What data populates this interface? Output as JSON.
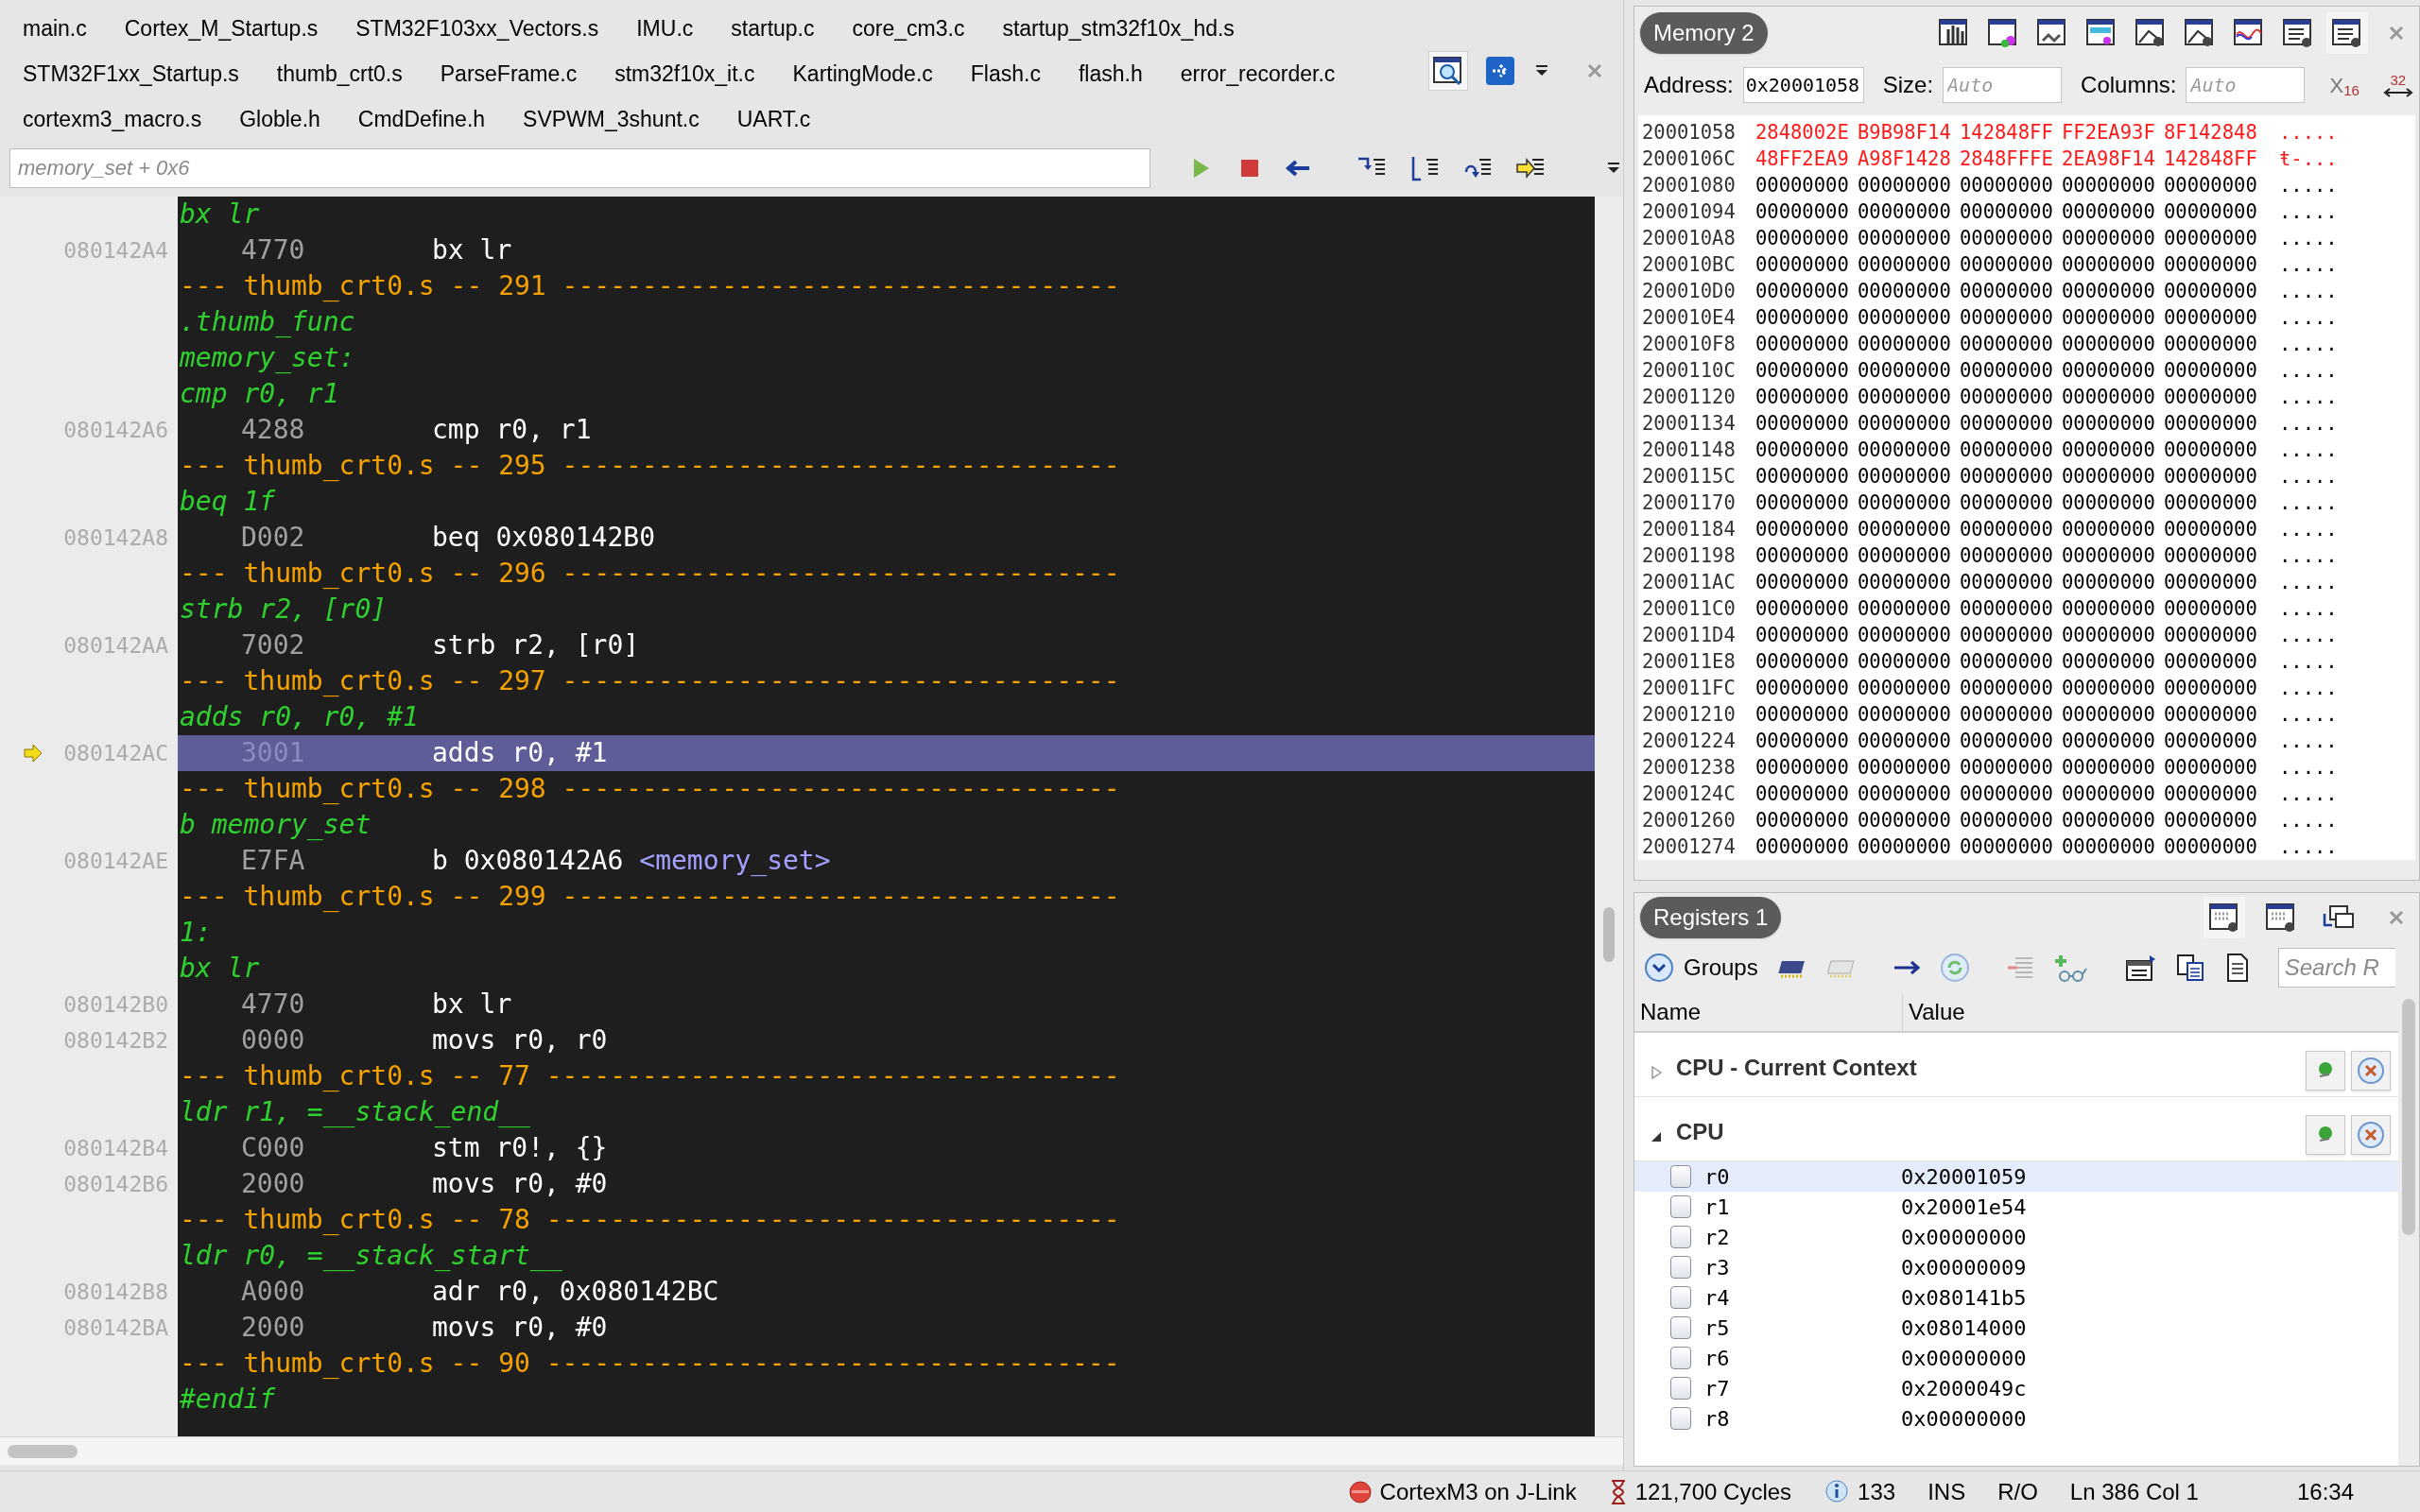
{
  "editor_tabs": [
    [
      "main.c",
      "Cortex_M_Startup.s",
      "STM32F103xx_Vectors.s",
      "IMU.c",
      "startup.c",
      "core_cm3.c",
      "startup_stm32f10x_hd.s"
    ],
    [
      "STM32F1xx_Startup.s",
      "thumb_crt0.s",
      "ParseFrame.c",
      "stm32f10x_it.c",
      "KartingMode.c",
      "Flash.c",
      "flash.h",
      "error_recorder.c"
    ],
    [
      "cortexm3_macro.s",
      "Globle.h",
      "CmdDefine.h",
      "SVPWM_3shunt.c",
      "UART.c"
    ]
  ],
  "location_field": {
    "placeholder": "memory_set + 0x6"
  },
  "disassembly": [
    {
      "kind": "source",
      "text": "bx lr"
    },
    {
      "kind": "instruction",
      "address": "080142A4",
      "opcode": "4770",
      "text": "bx lr",
      "current": false
    },
    {
      "kind": "file",
      "text": "--- thumb_crt0.s -- 291 -----------------------------------"
    },
    {
      "kind": "source",
      "text": ".thumb_func"
    },
    {
      "kind": "source",
      "text": "memory_set:"
    },
    {
      "kind": "source",
      "text": "cmp r0, r1"
    },
    {
      "kind": "instruction",
      "address": "080142A6",
      "opcode": "4288",
      "text": "cmp r0, r1",
      "current": false
    },
    {
      "kind": "file",
      "text": "--- thumb_crt0.s -- 295 -----------------------------------"
    },
    {
      "kind": "source",
      "text": "beq 1f"
    },
    {
      "kind": "instruction",
      "address": "080142A8",
      "opcode": "D002",
      "text": "beq 0x080142B0",
      "current": false
    },
    {
      "kind": "file",
      "text": "--- thumb_crt0.s -- 296 -----------------------------------"
    },
    {
      "kind": "source",
      "text": "strb r2, [r0]"
    },
    {
      "kind": "instruction",
      "address": "080142AA",
      "opcode": "7002",
      "text": "strb r2, [r0]",
      "current": false
    },
    {
      "kind": "file",
      "text": "--- thumb_crt0.s -- 297 -----------------------------------"
    },
    {
      "kind": "source",
      "text": "adds r0, r0, #1"
    },
    {
      "kind": "instruction",
      "address": "080142AC",
      "opcode": "3001",
      "text": "adds r0, #1",
      "current": true
    },
    {
      "kind": "file",
      "text": "--- thumb_crt0.s -- 298 -----------------------------------"
    },
    {
      "kind": "source",
      "text": "b memory_set"
    },
    {
      "kind": "instruction",
      "address": "080142AE",
      "opcode": "E7FA",
      "text": "b 0x080142A6",
      "symbol": "<memory_set>",
      "current": false
    },
    {
      "kind": "file",
      "text": "--- thumb_crt0.s -- 299 -----------------------------------"
    },
    {
      "kind": "source",
      "text": "1:"
    },
    {
      "kind": "source",
      "text": "bx lr"
    },
    {
      "kind": "instruction",
      "address": "080142B0",
      "opcode": "4770",
      "text": "bx lr",
      "current": false
    },
    {
      "kind": "instruction",
      "address": "080142B2",
      "opcode": "0000",
      "text": "movs r0, r0",
      "current": false
    },
    {
      "kind": "file",
      "text": "--- thumb_crt0.s -- 77 ------------------------------------"
    },
    {
      "kind": "source",
      "text": "ldr r1, =__stack_end__"
    },
    {
      "kind": "instruction",
      "address": "080142B4",
      "opcode": "C000",
      "text": "stm r0!, {}",
      "current": false
    },
    {
      "kind": "instruction",
      "address": "080142B6",
      "opcode": "2000",
      "text": "movs r0, #0",
      "current": false
    },
    {
      "kind": "file",
      "text": "--- thumb_crt0.s -- 78 ------------------------------------"
    },
    {
      "kind": "source",
      "text": "ldr r0, =__stack_start__"
    },
    {
      "kind": "instruction",
      "address": "080142B8",
      "opcode": "A000",
      "text": "adr r0, 0x080142BC",
      "current": false
    },
    {
      "kind": "instruction",
      "address": "080142BA",
      "opcode": "2000",
      "text": "movs r0, #0",
      "current": false
    },
    {
      "kind": "file",
      "text": "--- thumb_crt0.s -- 90 ------------------------------------"
    },
    {
      "kind": "source",
      "text": "#endif"
    }
  ],
  "memory": {
    "title": "Memory 2",
    "address_label": "Address:",
    "address": "0x20001058",
    "size_label": "Size:",
    "size_placeholder": "Auto",
    "columns_label": "Columns:",
    "columns_placeholder": "Auto",
    "radix_button": "X$_{16}$",
    "width_button": "32",
    "rows": [
      {
        "address": "20001058",
        "cells": [
          "2848002E",
          "B9B98F14",
          "142848FF",
          "FF2EA93F",
          "8F142848"
        ],
        "ascii": ".....",
        "changed": true
      },
      {
        "address": "2000106C",
        "cells": [
          "48FF2EA9",
          "A98F1428",
          "2848FFFE",
          "2EA98F14",
          "142848FF"
        ],
        "ascii": "ŧ-...",
        "changed": true
      },
      {
        "address": "20001080",
        "cells": [
          "00000000",
          "00000000",
          "00000000",
          "00000000",
          "00000000"
        ],
        "ascii": ".....",
        "changed": false
      },
      {
        "address": "20001094",
        "cells": [
          "00000000",
          "00000000",
          "00000000",
          "00000000",
          "00000000"
        ],
        "ascii": ".....",
        "changed": false
      },
      {
        "address": "200010A8",
        "cells": [
          "00000000",
          "00000000",
          "00000000",
          "00000000",
          "00000000"
        ],
        "ascii": ".....",
        "changed": false
      },
      {
        "address": "200010BC",
        "cells": [
          "00000000",
          "00000000",
          "00000000",
          "00000000",
          "00000000"
        ],
        "ascii": ".....",
        "changed": false
      },
      {
        "address": "200010D0",
        "cells": [
          "00000000",
          "00000000",
          "00000000",
          "00000000",
          "00000000"
        ],
        "ascii": ".....",
        "changed": false
      },
      {
        "address": "200010E4",
        "cells": [
          "00000000",
          "00000000",
          "00000000",
          "00000000",
          "00000000"
        ],
        "ascii": ".....",
        "changed": false
      },
      {
        "address": "200010F8",
        "cells": [
          "00000000",
          "00000000",
          "00000000",
          "00000000",
          "00000000"
        ],
        "ascii": ".....",
        "changed": false
      },
      {
        "address": "2000110C",
        "cells": [
          "00000000",
          "00000000",
          "00000000",
          "00000000",
          "00000000"
        ],
        "ascii": ".....",
        "changed": false
      },
      {
        "address": "20001120",
        "cells": [
          "00000000",
          "00000000",
          "00000000",
          "00000000",
          "00000000"
        ],
        "ascii": ".....",
        "changed": false
      },
      {
        "address": "20001134",
        "cells": [
          "00000000",
          "00000000",
          "00000000",
          "00000000",
          "00000000"
        ],
        "ascii": ".....",
        "changed": false
      },
      {
        "address": "20001148",
        "cells": [
          "00000000",
          "00000000",
          "00000000",
          "00000000",
          "00000000"
        ],
        "ascii": ".....",
        "changed": false
      },
      {
        "address": "2000115C",
        "cells": [
          "00000000",
          "00000000",
          "00000000",
          "00000000",
          "00000000"
        ],
        "ascii": ".....",
        "changed": false
      },
      {
        "address": "20001170",
        "cells": [
          "00000000",
          "00000000",
          "00000000",
          "00000000",
          "00000000"
        ],
        "ascii": ".....",
        "changed": false
      },
      {
        "address": "20001184",
        "cells": [
          "00000000",
          "00000000",
          "00000000",
          "00000000",
          "00000000"
        ],
        "ascii": ".....",
        "changed": false
      },
      {
        "address": "20001198",
        "cells": [
          "00000000",
          "00000000",
          "00000000",
          "00000000",
          "00000000"
        ],
        "ascii": ".....",
        "changed": false
      },
      {
        "address": "200011AC",
        "cells": [
          "00000000",
          "00000000",
          "00000000",
          "00000000",
          "00000000"
        ],
        "ascii": ".....",
        "changed": false
      },
      {
        "address": "200011C0",
        "cells": [
          "00000000",
          "00000000",
          "00000000",
          "00000000",
          "00000000"
        ],
        "ascii": ".....",
        "changed": false
      },
      {
        "address": "200011D4",
        "cells": [
          "00000000",
          "00000000",
          "00000000",
          "00000000",
          "00000000"
        ],
        "ascii": ".....",
        "changed": false
      },
      {
        "address": "200011E8",
        "cells": [
          "00000000",
          "00000000",
          "00000000",
          "00000000",
          "00000000"
        ],
        "ascii": ".....",
        "changed": false
      },
      {
        "address": "200011FC",
        "cells": [
          "00000000",
          "00000000",
          "00000000",
          "00000000",
          "00000000"
        ],
        "ascii": ".....",
        "changed": false
      },
      {
        "address": "20001210",
        "cells": [
          "00000000",
          "00000000",
          "00000000",
          "00000000",
          "00000000"
        ],
        "ascii": ".....",
        "changed": false
      },
      {
        "address": "20001224",
        "cells": [
          "00000000",
          "00000000",
          "00000000",
          "00000000",
          "00000000"
        ],
        "ascii": ".....",
        "changed": false
      },
      {
        "address": "20001238",
        "cells": [
          "00000000",
          "00000000",
          "00000000",
          "00000000",
          "00000000"
        ],
        "ascii": ".....",
        "changed": false
      },
      {
        "address": "2000124C",
        "cells": [
          "00000000",
          "00000000",
          "00000000",
          "00000000",
          "00000000"
        ],
        "ascii": ".....",
        "changed": false
      },
      {
        "address": "20001260",
        "cells": [
          "00000000",
          "00000000",
          "00000000",
          "00000000",
          "00000000"
        ],
        "ascii": ".....",
        "changed": false
      },
      {
        "address": "20001274",
        "cells": [
          "00000000",
          "00000000",
          "00000000",
          "00000000",
          "00000000"
        ],
        "ascii": ".....",
        "changed": false
      }
    ]
  },
  "registers": {
    "title": "Registers 1",
    "groups_label": "Groups",
    "search_placeholder": "Search R",
    "columns": [
      "Name",
      "Value"
    ],
    "groups": [
      {
        "name": "CPU - Current Context",
        "expanded": false
      },
      {
        "name": "CPU",
        "expanded": true,
        "children": [
          {
            "name": "r0",
            "value": "0x20001059",
            "selected": true
          },
          {
            "name": "r1",
            "value": "0x20001e54",
            "selected": false
          },
          {
            "name": "r2",
            "value": "0x00000000",
            "selected": false
          },
          {
            "name": "r3",
            "value": "0x00000009",
            "selected": false
          },
          {
            "name": "r4",
            "value": "0x080141b5",
            "selected": false
          },
          {
            "name": "r5",
            "value": "0x08014000",
            "selected": false
          },
          {
            "name": "r6",
            "value": "0x00000000",
            "selected": false
          },
          {
            "name": "r7",
            "value": "0x2000049c",
            "selected": false
          },
          {
            "name": "r8",
            "value": "0x00000000",
            "selected": false
          }
        ]
      }
    ]
  },
  "status_bar": {
    "target": "CortexM3 on J-Link",
    "cycles": "121,700 Cycles",
    "info": "133",
    "mode": "INS",
    "access": "R/O",
    "position": "Ln 386 Col 1",
    "time": "16:34"
  }
}
